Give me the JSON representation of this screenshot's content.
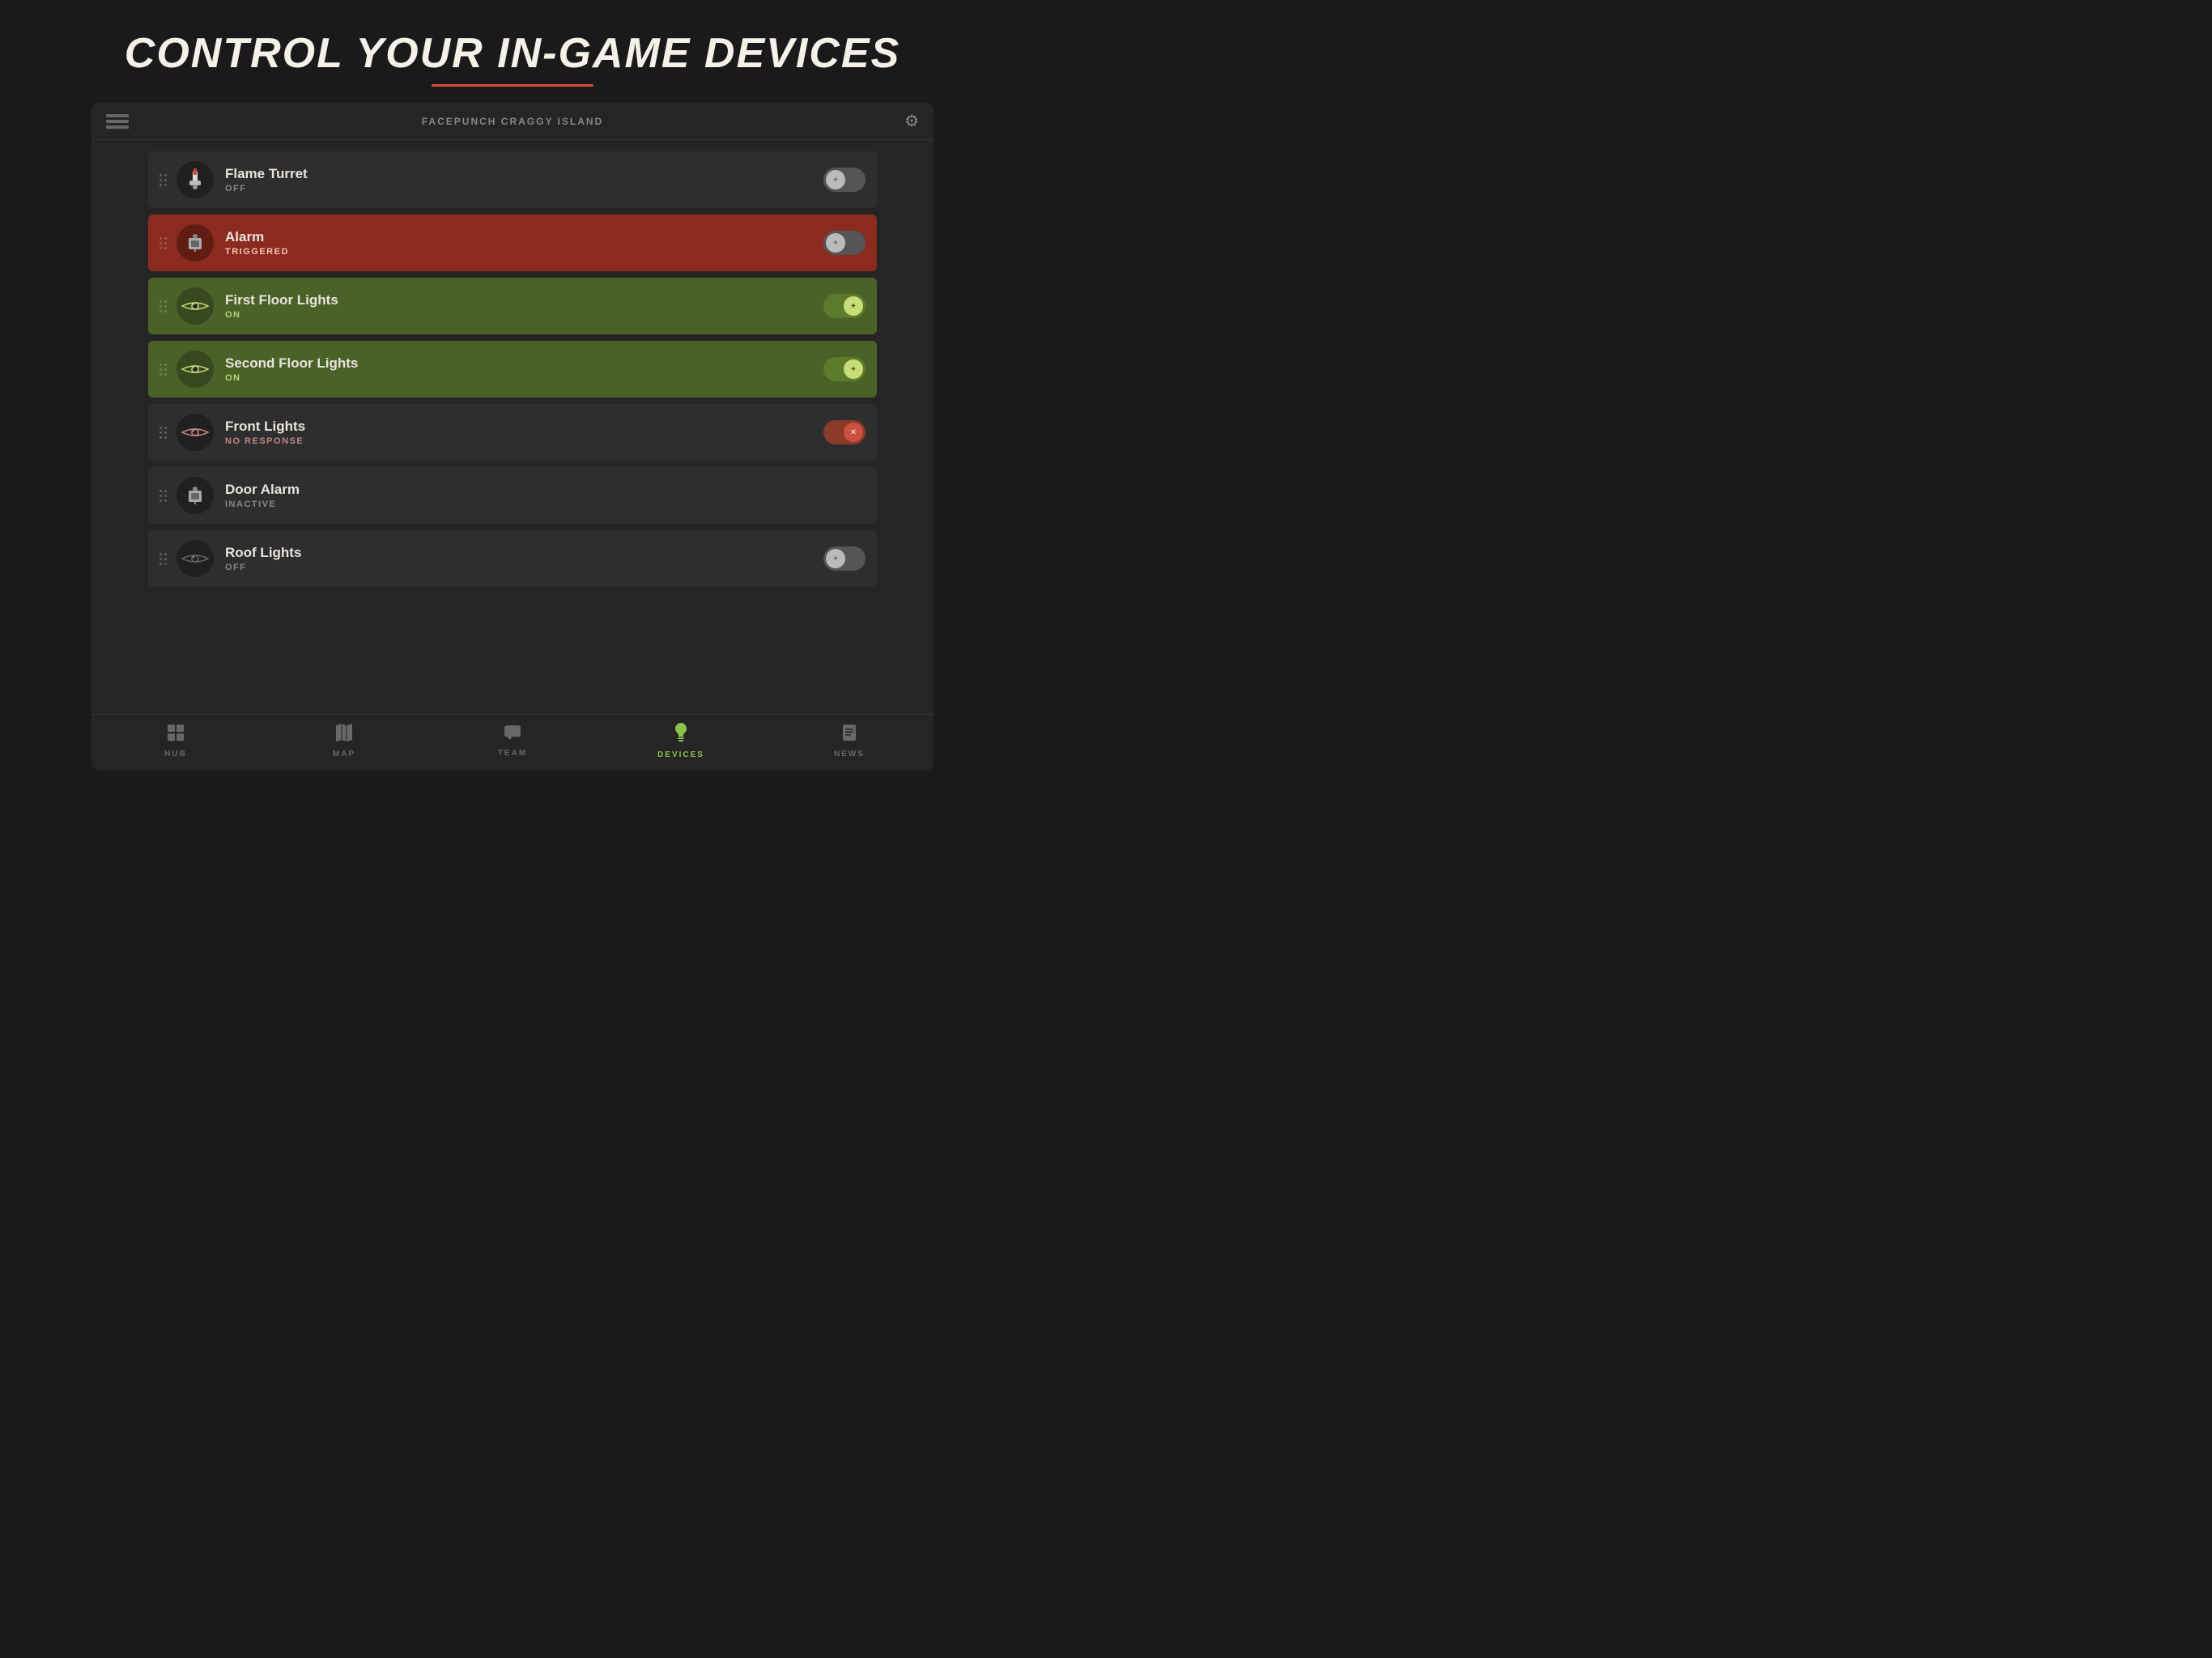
{
  "page": {
    "title": "CONTROL YOUR IN-GAME DEVICES",
    "title_underline_color": "#d94f3a"
  },
  "header": {
    "server_name": "FACEPUNCH CRAGGY ISLAND",
    "settings_label": "settings"
  },
  "devices": [
    {
      "id": "flame-turret",
      "name": "Flame Turret",
      "status": "OFF",
      "status_type": "off",
      "row_style": "default",
      "toggle_state": "off",
      "icon_type": "turret"
    },
    {
      "id": "alarm",
      "name": "Alarm",
      "status": "TRIGGERED",
      "status_type": "triggered",
      "row_style": "triggered",
      "toggle_state": "off",
      "icon_type": "alarm"
    },
    {
      "id": "first-floor-lights",
      "name": "First Floor Lights",
      "status": "ON",
      "status_type": "on",
      "row_style": "on",
      "toggle_state": "on",
      "icon_type": "light"
    },
    {
      "id": "second-floor-lights",
      "name": "Second Floor Lights",
      "status": "ON",
      "status_type": "on",
      "row_style": "on",
      "toggle_state": "on",
      "icon_type": "light"
    },
    {
      "id": "front-lights",
      "name": "Front Lights",
      "status": "NO RESPONSE",
      "status_type": "no-response",
      "row_style": "default",
      "toggle_state": "error",
      "icon_type": "light"
    },
    {
      "id": "door-alarm",
      "name": "Door Alarm",
      "status": "INACTIVE",
      "status_type": "inactive",
      "row_style": "default",
      "toggle_state": "none",
      "icon_type": "alarm"
    },
    {
      "id": "roof-lights",
      "name": "Roof Lights",
      "status": "OFF",
      "status_type": "off",
      "row_style": "default",
      "toggle_state": "off",
      "icon_type": "light"
    }
  ],
  "nav": {
    "items": [
      {
        "id": "hub",
        "label": "HUB",
        "icon": "grid",
        "active": false
      },
      {
        "id": "map",
        "label": "MAP",
        "icon": "map",
        "active": false
      },
      {
        "id": "team",
        "label": "TEAM",
        "icon": "chat",
        "active": false
      },
      {
        "id": "devices",
        "label": "DEVICES",
        "icon": "bulb",
        "active": true
      },
      {
        "id": "news",
        "label": "NEWS",
        "icon": "doc",
        "active": false
      }
    ]
  }
}
